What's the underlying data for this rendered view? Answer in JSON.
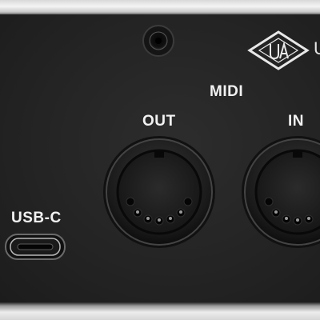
{
  "labels": {
    "midi": "MIDI",
    "out": "OUT",
    "in": "IN",
    "usb_c": "USB-C",
    "brand_partial": "U"
  },
  "icons": {
    "logo": "ua-diamond-logo-icon",
    "jack": "round-jack-icon",
    "midi_out": "midi-din-port-icon",
    "midi_in": "midi-din-port-icon",
    "usb": "usb-c-port-icon"
  },
  "colors": {
    "panel": "#262626",
    "label": "#f2f2f2",
    "chassis": "#e9e9e9"
  }
}
